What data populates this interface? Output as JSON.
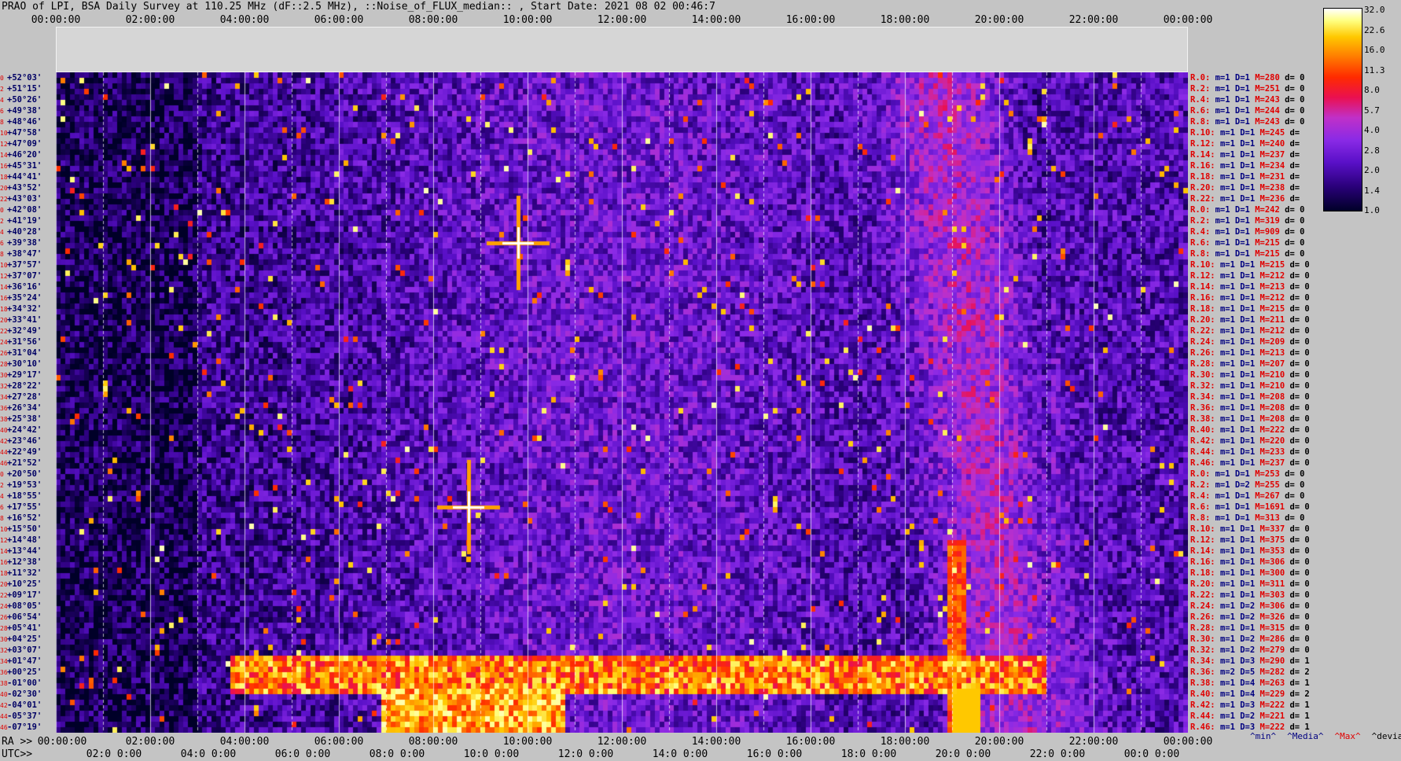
{
  "title": "PRAO of LPI, BSA Daily Survey at 110.25 MHz (dF::2.5 MHz), ::Noise_of_FLUX_median:: , Start Date: 2021 08 02 00:46:7",
  "chart_data": {
    "type": "heatmap",
    "title": "PRAO of LPI, BSA Daily Survey at 110.25 MHz (dF::2.5 MHz), ::Noise_of_FLUX_median:: , Start Date: 2021 08 02 00:46:7",
    "x_axis_top": {
      "ticks": [
        "00:00:00",
        "02:00:00",
        "04:00:00",
        "06:00:00",
        "08:00:00",
        "10:00:00",
        "12:00:00",
        "14:00:00",
        "16:00:00",
        "18:00:00",
        "20:00:00",
        "22:00:00",
        "00:00:00"
      ]
    },
    "x_axis_ra": {
      "prefix": "RA >>",
      "ticks": [
        "00:00:00",
        "02:00:00",
        "04:00:00",
        "06:00:00",
        "08:00:00",
        "10:00:00",
        "12:00:00",
        "14:00:00",
        "16:00:00",
        "18:00:00",
        "20:00:00",
        "22:00:00",
        "00:00:00"
      ]
    },
    "x_axis_utc": {
      "prefix": "UTC>>",
      "ticks": [
        "02:0 0:00",
        "04:0 0:00",
        "06:0 0:00",
        "08:0 0:00",
        "10:0 0:00",
        "12:0 0:00",
        "14:0 0:00",
        "16:0 0:00",
        "18:0 0:00",
        "20:0 0:00",
        "22:0 0:00",
        "00:0 0:00"
      ]
    },
    "declinations": [
      "+52°03'",
      "+51°15'",
      "+50°26'",
      "+49°38'",
      "+48°46'",
      "+47°58'",
      "+47°09'",
      "+46°20'",
      "+45°31'",
      "+44°41'",
      "+43°52'",
      "+43°03'",
      "+42°08'",
      "+41°19'",
      "+40°28'",
      "+39°38'",
      "+38°47'",
      "+37°57'",
      "+37°07'",
      "+36°16'",
      "+35°24'",
      "+34°32'",
      "+33°41'",
      "+32°49'",
      "+31°56'",
      "+31°04'",
      "+30°10'",
      "+29°17'",
      "+28°22'",
      "+27°28'",
      "+26°34'",
      "+25°38'",
      "+24°42'",
      "+23°46'",
      "+22°49'",
      "+21°52'",
      "+20°50'",
      "+19°53'",
      "+18°55'",
      "+17°55'",
      "+16°52'",
      "+15°50'",
      "+14°48'",
      "+13°44'",
      "+12°38'",
      "+11°32'",
      "+10°25'",
      "+09°17'",
      "+08°05'",
      "+06°54'",
      "+05°41'",
      "+04°25'",
      "+03°07'",
      "+01°47'",
      "+00°25'",
      "-01°00'",
      "-02°30'",
      "-04°01'",
      "-05°37'",
      "-07°19'"
    ],
    "row_indices": [
      "0",
      "2",
      "4",
      "6",
      "8",
      "10",
      "12",
      "14",
      "16",
      "18",
      "20",
      "22",
      "0",
      "2",
      "4",
      "6",
      "8",
      "10",
      "12",
      "14",
      "16",
      "18",
      "20",
      "22",
      "24",
      "26",
      "28",
      "30",
      "32",
      "34",
      "36",
      "38",
      "40",
      "42",
      "44",
      "46",
      "0",
      "2",
      "4",
      "6",
      "8",
      "10",
      "12",
      "14",
      "16",
      "18",
      "20",
      "22",
      "24",
      "26",
      "28",
      "30",
      "32",
      "34",
      "36",
      "38",
      "40",
      "42",
      "44",
      "46"
    ],
    "row_stats": [
      {
        "r": "R.0:",
        "m": "m=1",
        "D": "D=1",
        "M": "M=280",
        "d": "d= 0"
      },
      {
        "r": "R.2:",
        "m": "m=1",
        "D": "D=1",
        "M": "M=251",
        "d": "d= 0"
      },
      {
        "r": "R.4:",
        "m": "m=1",
        "D": "D=1",
        "M": "M=243",
        "d": "d= 0"
      },
      {
        "r": "R.6:",
        "m": "m=1",
        "D": "D=1",
        "M": "M=244",
        "d": "d= 0"
      },
      {
        "r": "R.8:",
        "m": "m=1",
        "D": "D=1",
        "M": "M=243",
        "d": "d= 0"
      },
      {
        "r": "R.10:",
        "m": "m=1",
        "D": "D=1",
        "M": "M=245",
        "d": "d="
      },
      {
        "r": "R.12:",
        "m": "m=1",
        "D": "D=1",
        "M": "M=240",
        "d": "d="
      },
      {
        "r": "R.14:",
        "m": "m=1",
        "D": "D=1",
        "M": "M=237",
        "d": "d="
      },
      {
        "r": "R.16:",
        "m": "m=1",
        "D": "D=1",
        "M": "M=234",
        "d": "d="
      },
      {
        "r": "R.18:",
        "m": "m=1",
        "D": "D=1",
        "M": "M=231",
        "d": "d="
      },
      {
        "r": "R.20:",
        "m": "m=1",
        "D": "D=1",
        "M": "M=238",
        "d": "d="
      },
      {
        "r": "R.22:",
        "m": "m=1",
        "D": "D=1",
        "M": "M=236",
        "d": "d="
      },
      {
        "r": "R.0:",
        "m": "m=1",
        "D": "D=1",
        "M": "M=242",
        "d": "d= 0"
      },
      {
        "r": "R.2:",
        "m": "m=1",
        "D": "D=1",
        "M": "M=319",
        "d": "d= 0"
      },
      {
        "r": "R.4:",
        "m": "m=1",
        "D": "D=1",
        "M": "M=909",
        "d": "d= 0"
      },
      {
        "r": "R.6:",
        "m": "m=1",
        "D": "D=1",
        "M": "M=215",
        "d": "d= 0"
      },
      {
        "r": "R.8:",
        "m": "m=1",
        "D": "D=1",
        "M": "M=215",
        "d": "d= 0"
      },
      {
        "r": "R.10:",
        "m": "m=1",
        "D": "D=1",
        "M": "M=215",
        "d": "d= 0"
      },
      {
        "r": "R.12:",
        "m": "m=1",
        "D": "D=1",
        "M": "M=212",
        "d": "d= 0"
      },
      {
        "r": "R.14:",
        "m": "m=1",
        "D": "D=1",
        "M": "M=213",
        "d": "d= 0"
      },
      {
        "r": "R.16:",
        "m": "m=1",
        "D": "D=1",
        "M": "M=212",
        "d": "d= 0"
      },
      {
        "r": "R.18:",
        "m": "m=1",
        "D": "D=1",
        "M": "M=215",
        "d": "d= 0"
      },
      {
        "r": "R.20:",
        "m": "m=1",
        "D": "D=1",
        "M": "M=211",
        "d": "d= 0"
      },
      {
        "r": "R.22:",
        "m": "m=1",
        "D": "D=1",
        "M": "M=212",
        "d": "d= 0"
      },
      {
        "r": "R.24:",
        "m": "m=1",
        "D": "D=1",
        "M": "M=209",
        "d": "d= 0"
      },
      {
        "r": "R.26:",
        "m": "m=1",
        "D": "D=1",
        "M": "M=213",
        "d": "d= 0"
      },
      {
        "r": "R.28:",
        "m": "m=1",
        "D": "D=1",
        "M": "M=207",
        "d": "d= 0"
      },
      {
        "r": "R.30:",
        "m": "m=1",
        "D": "D=1",
        "M": "M=210",
        "d": "d= 0"
      },
      {
        "r": "R.32:",
        "m": "m=1",
        "D": "D=1",
        "M": "M=210",
        "d": "d= 0"
      },
      {
        "r": "R.34:",
        "m": "m=1",
        "D": "D=1",
        "M": "M=208",
        "d": "d= 0"
      },
      {
        "r": "R.36:",
        "m": "m=1",
        "D": "D=1",
        "M": "M=208",
        "d": "d= 0"
      },
      {
        "r": "R.38:",
        "m": "m=1",
        "D": "D=1",
        "M": "M=208",
        "d": "d= 0"
      },
      {
        "r": "R.40:",
        "m": "m=1",
        "D": "D=1",
        "M": "M=222",
        "d": "d= 0"
      },
      {
        "r": "R.42:",
        "m": "m=1",
        "D": "D=1",
        "M": "M=220",
        "d": "d= 0"
      },
      {
        "r": "R.44:",
        "m": "m=1",
        "D": "D=1",
        "M": "M=233",
        "d": "d= 0"
      },
      {
        "r": "R.46:",
        "m": "m=1",
        "D": "D=1",
        "M": "M=237",
        "d": "d= 0"
      },
      {
        "r": "R.0:",
        "m": "m=1",
        "D": "D=1",
        "M": "M=253",
        "d": "d= 0"
      },
      {
        "r": "R.2:",
        "m": "m=1",
        "D": "D=2",
        "M": "M=255",
        "d": "d= 0"
      },
      {
        "r": "R.4:",
        "m": "m=1",
        "D": "D=1",
        "M": "M=267",
        "d": "d= 0"
      },
      {
        "r": "R.6:",
        "m": "m=1",
        "D": "D=1",
        "M": "M=1691",
        "d": "d= 0"
      },
      {
        "r": "R.8:",
        "m": "m=1",
        "D": "D=1",
        "M": "M=313",
        "d": "d= 0"
      },
      {
        "r": "R.10:",
        "m": "m=1",
        "D": "D=1",
        "M": "M=337",
        "d": "d= 0"
      },
      {
        "r": "R.12:",
        "m": "m=1",
        "D": "D=1",
        "M": "M=375",
        "d": "d= 0"
      },
      {
        "r": "R.14:",
        "m": "m=1",
        "D": "D=1",
        "M": "M=353",
        "d": "d= 0"
      },
      {
        "r": "R.16:",
        "m": "m=1",
        "D": "D=1",
        "M": "M=306",
        "d": "d= 0"
      },
      {
        "r": "R.18:",
        "m": "m=1",
        "D": "D=1",
        "M": "M=300",
        "d": "d= 0"
      },
      {
        "r": "R.20:",
        "m": "m=1",
        "D": "D=1",
        "M": "M=311",
        "d": "d= 0"
      },
      {
        "r": "R.22:",
        "m": "m=1",
        "D": "D=1",
        "M": "M=303",
        "d": "d= 0"
      },
      {
        "r": "R.24:",
        "m": "m=1",
        "D": "D=2",
        "M": "M=306",
        "d": "d= 0"
      },
      {
        "r": "R.26:",
        "m": "m=1",
        "D": "D=2",
        "M": "M=326",
        "d": "d= 0"
      },
      {
        "r": "R.28:",
        "m": "m=1",
        "D": "D=1",
        "M": "M=315",
        "d": "d= 0"
      },
      {
        "r": "R.30:",
        "m": "m=1",
        "D": "D=2",
        "M": "M=286",
        "d": "d= 0"
      },
      {
        "r": "R.32:",
        "m": "m=1",
        "D": "D=2",
        "M": "M=279",
        "d": "d= 0"
      },
      {
        "r": "R.34:",
        "m": "m=1",
        "D": "D=3",
        "M": "M=290",
        "d": "d= 1"
      },
      {
        "r": "R.36:",
        "m": "m=2",
        "D": "D=5",
        "M": "M=282",
        "d": "d= 2"
      },
      {
        "r": "R.38:",
        "m": "m=1",
        "D": "D=4",
        "M": "M=263",
        "d": "d= 1"
      },
      {
        "r": "R.40:",
        "m": "m=1",
        "D": "D=4",
        "M": "M=229",
        "d": "d= 2"
      },
      {
        "r": "R.42:",
        "m": "m=1",
        "D": "D=3",
        "M": "M=222",
        "d": "d= 1"
      },
      {
        "r": "R.44:",
        "m": "m=1",
        "D": "D=2",
        "M": "M=221",
        "d": "d= 1"
      },
      {
        "r": "R.46:",
        "m": "m=1",
        "D": "D=3",
        "M": "M=222",
        "d": "d= 1"
      }
    ],
    "stat_legend": [
      "^min^",
      "^Media^",
      "^Max^",
      "^devia^"
    ],
    "colorbar": {
      "ticks": [
        "32.0",
        "22.6",
        "16.0",
        "11.3",
        "8.0",
        "5.7",
        "4.0",
        "2.8",
        "2.0",
        "1.4",
        "1.0"
      ],
      "range": [
        1.0,
        32.0
      ],
      "scale": "log2",
      "colors": [
        "#000028",
        "#2a007a",
        "#5a10c8",
        "#8a2ae6",
        "#c030c8",
        "#ea1050",
        "#ff2a00",
        "#ff7a00",
        "#ffc800",
        "#ffff80",
        "#ffffff"
      ]
    },
    "features": [
      {
        "type": "point",
        "x_hour": 9.8,
        "row": 15,
        "level": 32
      },
      {
        "type": "point",
        "x_hour": 8.75,
        "row": 39,
        "level": 32
      },
      {
        "type": "vertical_band",
        "x_hour": 18.75,
        "level": 8
      },
      {
        "type": "horizontal_band",
        "row_from": 53,
        "row_to": 59,
        "level": 16
      }
    ]
  }
}
